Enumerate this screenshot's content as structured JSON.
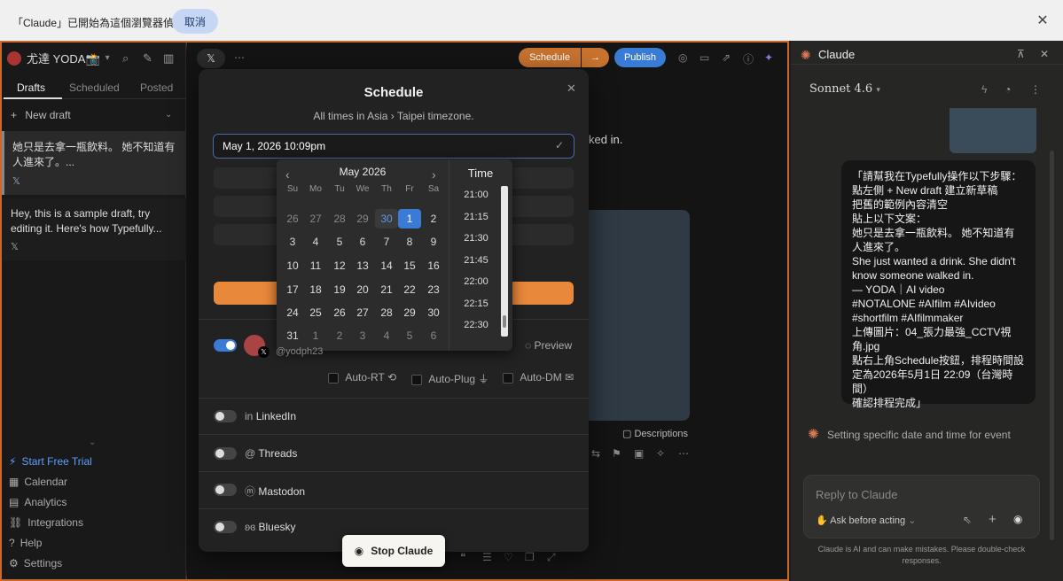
{
  "notification": {
    "message": "「Claude」已開始為這個瀏覽器偵錯",
    "cancel": "取消",
    "close": "✕"
  },
  "sidebar": {
    "workspace": "尤達 YODA📸",
    "tabs": [
      "Drafts",
      "Scheduled",
      "Posted"
    ],
    "new_draft": "New draft",
    "drafts": [
      {
        "text": "她只是去拿一瓶飲料。 她不知道有人進來了。..."
      },
      {
        "text": "Hey, this is a sample draft, try editing it. Here's how Typefully..."
      }
    ],
    "footer": [
      "Start Free Trial",
      "Calendar",
      "Analytics",
      "Integrations",
      "Help",
      "Settings"
    ]
  },
  "editor": {
    "schedule": "Schedule",
    "arrow": "→",
    "publish": "Publish",
    "snippet": "ked in.",
    "descriptions": "Descriptions"
  },
  "modal": {
    "title": "Schedule",
    "subtitle": "All times in  Asia › Taipei  timezone.",
    "date_value": "May 1, 2026 10:09pm",
    "calendar": {
      "month": "May 2026",
      "dow": [
        "Su",
        "Mo",
        "Tu",
        "We",
        "Th",
        "Fr",
        "Sa"
      ],
      "weeks": [
        [
          "26",
          "27",
          "28",
          "29",
          "30",
          "1",
          "2"
        ],
        [
          "3",
          "4",
          "5",
          "6",
          "7",
          "8",
          "9"
        ],
        [
          "10",
          "11",
          "12",
          "13",
          "14",
          "15",
          "16"
        ],
        [
          "17",
          "18",
          "19",
          "20",
          "21",
          "22",
          "23"
        ],
        [
          "24",
          "25",
          "26",
          "27",
          "28",
          "29",
          "30"
        ],
        [
          "31",
          "1",
          "2",
          "3",
          "4",
          "5",
          "6"
        ]
      ]
    },
    "time_header": "Time",
    "times": [
      "21:00",
      "21:15",
      "21:30",
      "21:45",
      "22:00",
      "22:15",
      "22:30"
    ],
    "account_handle": "@yodph23",
    "preview": "Preview",
    "options": [
      "Auto-RT",
      "Auto-Plug",
      "Auto-DM"
    ],
    "accounts": [
      "LinkedIn",
      "Threads",
      "Mastodon",
      "Bluesky"
    ]
  },
  "stop_button": "Stop Claude",
  "claude": {
    "title": "Claude",
    "model": "Sonnet 4.6",
    "message": "「請幫我在Typefully操作以下步驟：\n點左側 + New draft 建立新草稿\n把舊的範例內容清空\n貼上以下文案：\n她只是去拿一瓶飲料。 她不知道有人進來了。\nShe just wanted a drink. She didn't know someone walked in.\n— YODA｜AI video\n#NOTALONE #AIfilm #AIvideo #shortfilm #AIfilmmaker\n上傳圖片：04_張力最強_CCTV視角.jpg\n點右上角Schedule按鈕，排程時間設定為2026年5月1日 22:09（台灣時間）\n確認排程完成」",
    "status": "Setting specific date and time for event",
    "reply_placeholder": "Reply to Claude",
    "ask_mode": "Ask before acting",
    "disclaimer": "Claude is AI and can make mistakes. Please double-check responses."
  }
}
